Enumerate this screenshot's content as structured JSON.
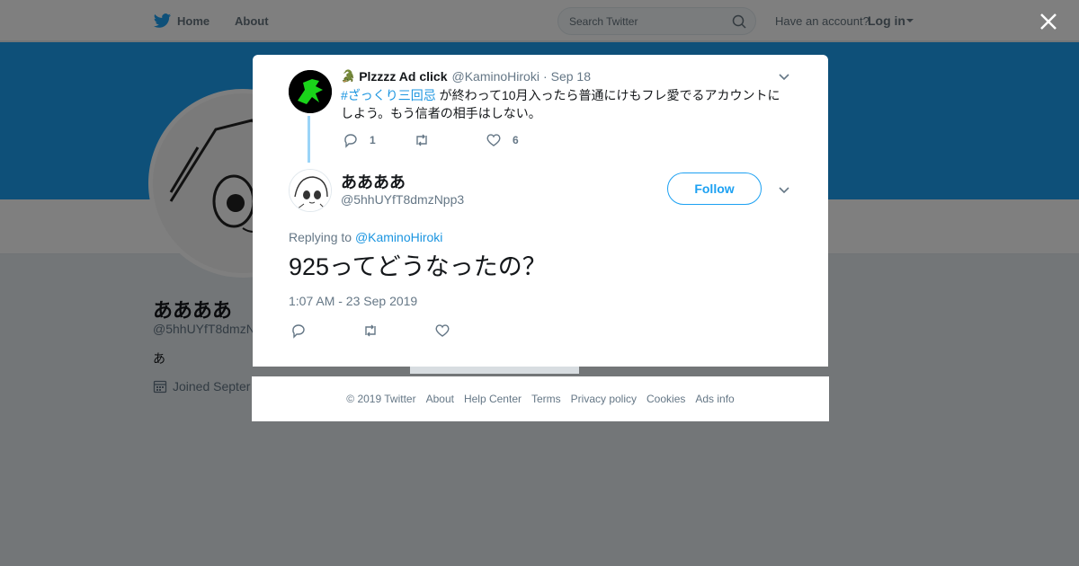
{
  "topnav": {
    "home_label": "Home",
    "about_label": "About",
    "search_placeholder": "Search Twitter",
    "have_account": "Have an account?",
    "login_label": "Log in",
    "brand_color": "#1da1f2"
  },
  "profile": {
    "name": "ああああ",
    "handle": "@5hhUYfT8dmzN",
    "bio": "あ",
    "joined": "Joined Septer",
    "banner_color": "#1da1f2"
  },
  "parent_tweet": {
    "emoji": "🐊",
    "name": "Plzzzz Ad click",
    "handle": "@KaminoHiroki",
    "separator": "·",
    "date": "Sep 18",
    "hashtag": "#ざっくり三回忌",
    "text": " が終わって10月入ったら普通にけもフレ愛でるアカウントにしよう。もう信者の相手はしない。",
    "reply_count": "1",
    "retweet_count": "",
    "like_count": "6"
  },
  "main_tweet": {
    "name": "ああああ",
    "handle": "@5hhUYfT8dmzNpp3",
    "follow_label": "Follow",
    "replying_prefix": "Replying to",
    "replying_to": "@KaminoHiroki",
    "text": "925ってどうなったの？",
    "timestamp": "1:07 AM - 23 Sep 2019"
  },
  "footer": {
    "links": [
      "© 2019 Twitter",
      "About",
      "Help Center",
      "Terms",
      "Privacy policy",
      "Cookies",
      "Ads info"
    ]
  },
  "icons": {
    "close": "close-icon",
    "search": "search-icon",
    "reply": "reply-icon",
    "retweet": "retweet-icon",
    "like": "heart-icon",
    "menu": "chevron-down-icon",
    "calendar": "calendar-icon"
  }
}
